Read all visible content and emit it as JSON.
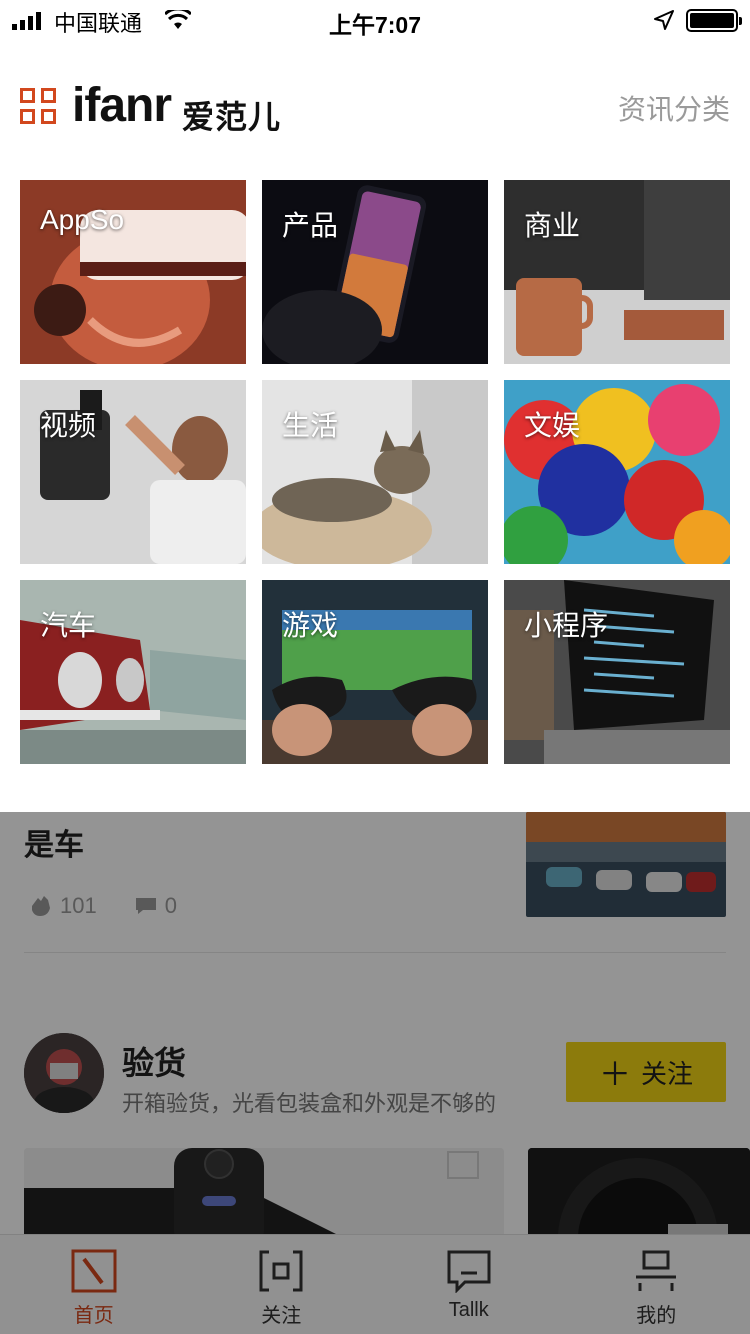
{
  "status_bar": {
    "carrier": "中国联通",
    "time": "上午7:07"
  },
  "header": {
    "logo_text": "ifanr",
    "logo_cn": "爱范儿",
    "category_link": "资讯分类"
  },
  "categories": [
    {
      "label": "AppSo",
      "icon": "vr-headset-photo"
    },
    {
      "label": "产品",
      "icon": "smartphone-photo"
    },
    {
      "label": "商业",
      "icon": "coffee-desk-photo"
    },
    {
      "label": "视频",
      "icon": "camera-operator-photo"
    },
    {
      "label": "生活",
      "icon": "cat-photo"
    },
    {
      "label": "文娱",
      "icon": "balloons-photo"
    },
    {
      "label": "汽车",
      "icon": "vintage-cars-photo"
    },
    {
      "label": "游戏",
      "icon": "game-controllers-photo"
    },
    {
      "label": "小程序",
      "icon": "laptop-code-photo"
    }
  ],
  "feed": {
    "article": {
      "title_tail": "是车",
      "likes": "101",
      "comments": "0"
    },
    "column": {
      "title": "验货",
      "description": "开箱验货，光看包装盒和外观是不够的",
      "follow_label": "关注"
    }
  },
  "tab_bar": {
    "tabs": [
      {
        "label": "首页",
        "active": true
      },
      {
        "label": "关注",
        "active": false
      },
      {
        "label": "Tallk",
        "active": false
      },
      {
        "label": "我的",
        "active": false
      }
    ]
  },
  "colors": {
    "brand": "#d2481e",
    "follow_button": "#f2d516"
  }
}
